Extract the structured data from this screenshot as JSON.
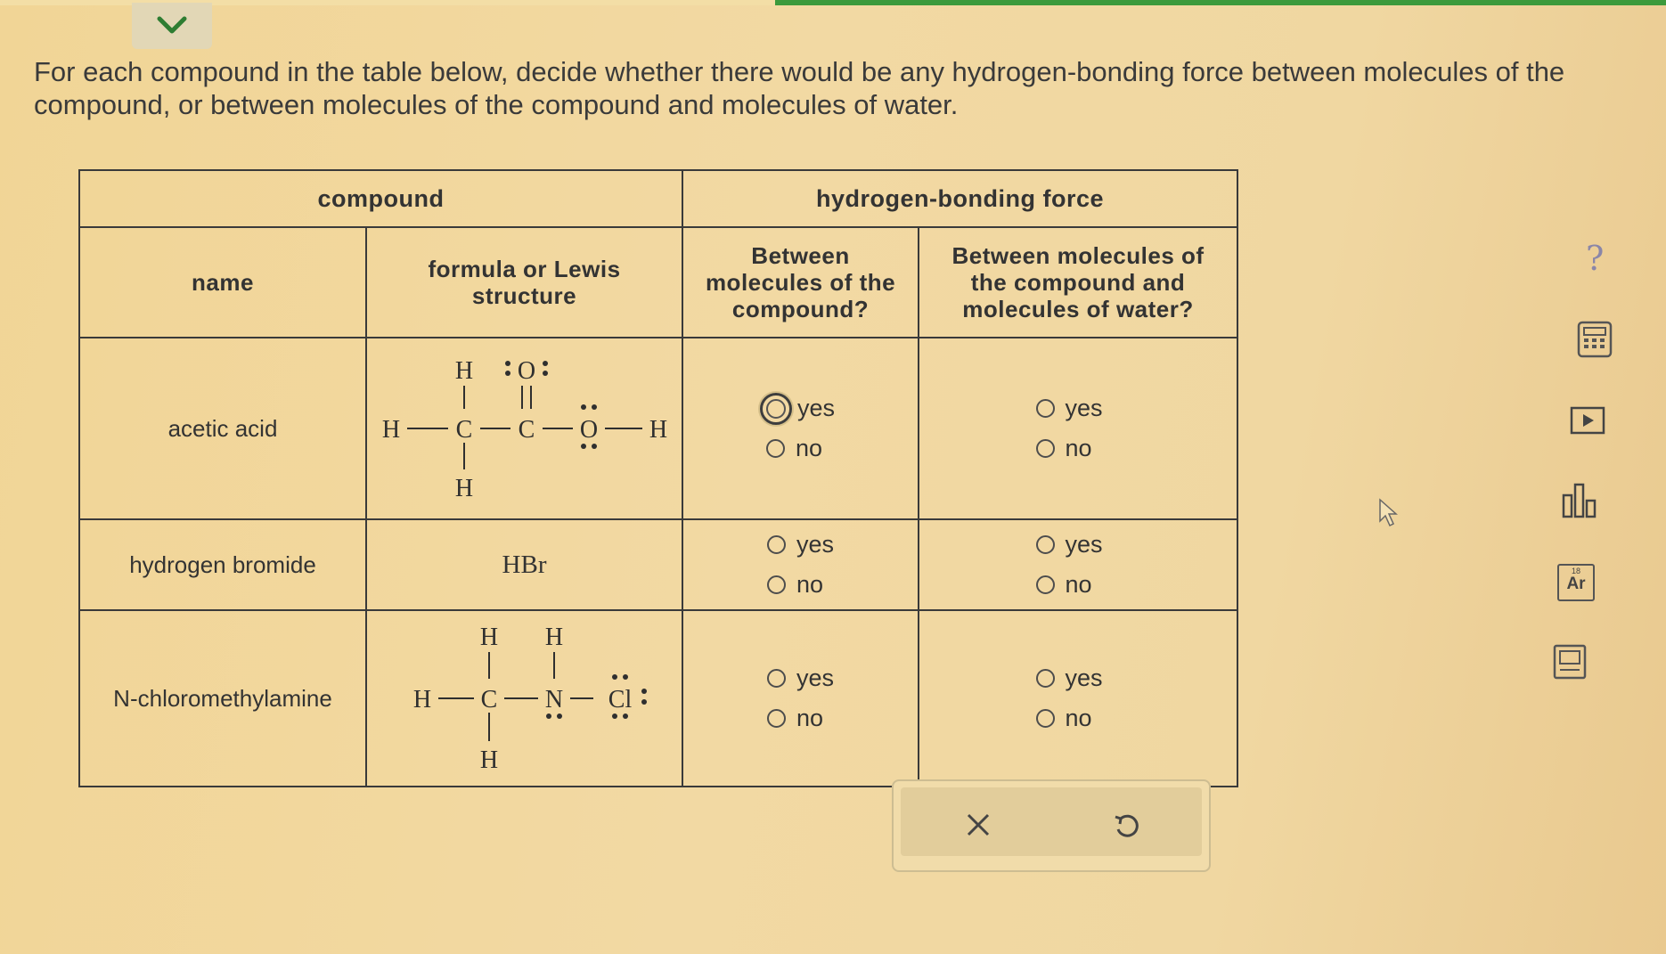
{
  "prompt": "For each compound in the table below, decide whether there would be any hydrogen-bonding force between molecules of the compound, or between molecules of the compound and molecules of water.",
  "table": {
    "group_headers": {
      "compound": "compound",
      "hbond": "hydrogen-bonding force"
    },
    "sub_headers": {
      "name": "name",
      "formula": "formula or Lewis structure",
      "between_compound": "Between molecules of the compound?",
      "between_water": "Between molecules of the compound and molecules of water?"
    },
    "rows": [
      {
        "name": "acetic acid",
        "lewis": {
          "h": "H",
          "c": "C",
          "o": "O"
        },
        "q1": {
          "yes": "yes",
          "no": "no",
          "selected": "yes"
        },
        "q2": {
          "yes": "yes",
          "no": "no",
          "selected": null
        }
      },
      {
        "name": "hydrogen bromide",
        "formula": "HBr",
        "q1": {
          "yes": "yes",
          "no": "no",
          "selected": null
        },
        "q2": {
          "yes": "yes",
          "no": "no",
          "selected": null
        }
      },
      {
        "name": "N-chloromethylamine",
        "lewis": {
          "h": "H",
          "c": "C",
          "n": "N",
          "cl": "Cl"
        },
        "q1": {
          "yes": "yes",
          "no": "no",
          "selected": null
        },
        "q2": {
          "yes": "yes",
          "no": "no",
          "selected": null
        }
      }
    ]
  },
  "actions": {
    "clear_icon": "x-icon",
    "undo_icon": "undo-icon"
  },
  "sidebar": {
    "help": "?",
    "icons": [
      "help-icon",
      "calculator-icon",
      "video-icon",
      "chart-icon",
      "periodic-table-icon",
      "textbook-icon"
    ],
    "periodic_label": "Ar",
    "periodic_number": "18"
  },
  "colors": {
    "background": "#f1d596",
    "progress": "#3c9a3c",
    "ink": "#333333"
  }
}
